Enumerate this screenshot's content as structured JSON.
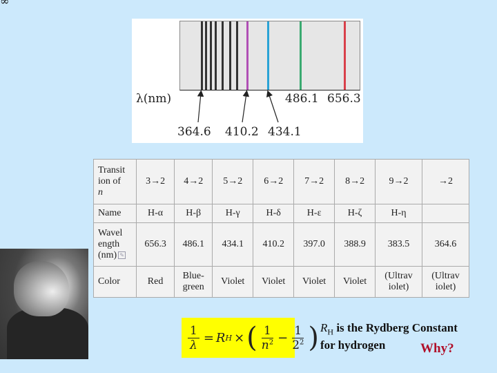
{
  "corner_glyph": "∞",
  "spectrum": {
    "axis_label": "λ(nm)",
    "upper_labels": [
      "486.1",
      "656.3"
    ],
    "lower_labels": [
      "364.6",
      "410.2",
      "434.1"
    ],
    "lines": [
      {
        "nm": 364.6,
        "color": "#333333"
      },
      {
        "nm": 366.0,
        "color": "#333333"
      },
      {
        "nm": 368.0,
        "color": "#333333"
      },
      {
        "nm": 371.0,
        "color": "#333333"
      },
      {
        "nm": 375.0,
        "color": "#333333"
      },
      {
        "nm": 383.5,
        "color": "#333333"
      },
      {
        "nm": 388.9,
        "color": "#333333"
      },
      {
        "nm": 410.2,
        "color": "#b04fb5"
      },
      {
        "nm": 434.1,
        "color": "#2aa3d6"
      },
      {
        "nm": 486.1,
        "color": "#3aaa70"
      },
      {
        "nm": 656.3,
        "color": "#d9404a"
      }
    ]
  },
  "table": {
    "row_headers": [
      "Transition of n",
      "Name",
      "Wavelength (nm)",
      "Color"
    ],
    "row_header_lines": [
      [
        "Transit",
        "ion of",
        "n"
      ],
      [
        "Name"
      ],
      [
        "Wavel",
        "ength",
        "(nm)"
      ],
      [
        "Color"
      ]
    ],
    "columns": [
      {
        "transition": "3→2",
        "name": "H-α",
        "wavelength": "656.3",
        "color": "Red"
      },
      {
        "transition": "4→2",
        "name": "H-β",
        "wavelength": "486.1",
        "color": "Blue-green"
      },
      {
        "transition": "5→2",
        "name": "H-γ",
        "wavelength": "434.1",
        "color": "Violet"
      },
      {
        "transition": "6→2",
        "name": "H-δ",
        "wavelength": "410.2",
        "color": "Violet"
      },
      {
        "transition": "7→2",
        "name": "H-ε",
        "wavelength": "397.0",
        "color": "Violet"
      },
      {
        "transition": "8→2",
        "name": "H-ζ",
        "wavelength": "388.9",
        "color": "Violet"
      },
      {
        "transition": "9→2",
        "name": "H-η",
        "wavelength": "383.5",
        "color": "(Ultraviolet)"
      },
      {
        "transition": "∞→2",
        "name": "",
        "wavelength": "364.6",
        "color": "(Ultraviolet)"
      }
    ],
    "transition_display_last": "→2",
    "color_lines": {
      "Blue-green": [
        "Blue-",
        "green"
      ],
      "(Ultraviolet)": [
        "(Ultrav",
        "iolet)"
      ]
    },
    "ref_icon": "edit-reference-icon"
  },
  "equation": {
    "lhs_num": "1",
    "lhs_den": "λ",
    "equals": "=",
    "constant": "R",
    "constant_sub": "H",
    "times": "×",
    "t1_num": "1",
    "t1_den": "n",
    "t1_exp": "2",
    "minus": "−",
    "t2_num": "1",
    "t2_den": "2",
    "t2_exp": "2",
    "background": "#ffff00"
  },
  "note": {
    "symbol": "R",
    "symbol_sub": "H",
    "line1_rest": " is the Rydberg Constant",
    "line2": "for hydrogen",
    "why": "Why?"
  }
}
